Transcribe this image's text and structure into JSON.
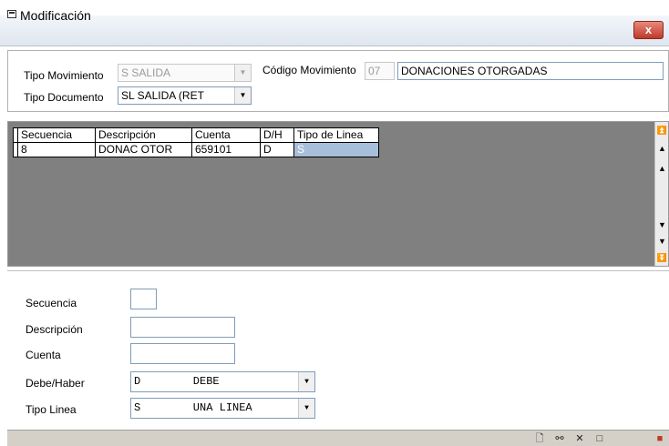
{
  "window": {
    "title": "Modificación",
    "close_label": "x"
  },
  "header": {
    "tipo_movimiento_label": "Tipo Movimiento",
    "tipo_movimiento_value": "S   SALIDA",
    "codigo_movimiento_label": "Código Movimiento",
    "codigo_movimiento_code": "07",
    "codigo_movimiento_desc": "DONACIONES OTORGADAS",
    "tipo_documento_label": "Tipo Documento",
    "tipo_documento_value": "SL      SALIDA (RET"
  },
  "grid": {
    "columns": [
      "Secuencia",
      "Descripción",
      "Cuenta",
      "D/H",
      "Tipo de Linea"
    ],
    "rows": [
      [
        "8",
        "DONAC OTOR",
        "659101",
        "D",
        "S"
      ]
    ]
  },
  "form": {
    "secuencia_label": "Secuencia",
    "secuencia_value": "",
    "descripcion_label": "Descripción",
    "descripcion_value": "",
    "cuenta_label": "Cuenta",
    "cuenta_value": "",
    "debe_haber_label": "Debe/Haber",
    "debe_haber_value": "D        DEBE",
    "tipo_linea_label": "Tipo Linea",
    "tipo_linea_value": "S        UNA LINEA"
  },
  "icons": {
    "window_icon": "form-window-icon",
    "toolbar": [
      "new-record-icon",
      "open-icon",
      "delete-icon",
      "save-icon",
      "exit-icon"
    ]
  }
}
